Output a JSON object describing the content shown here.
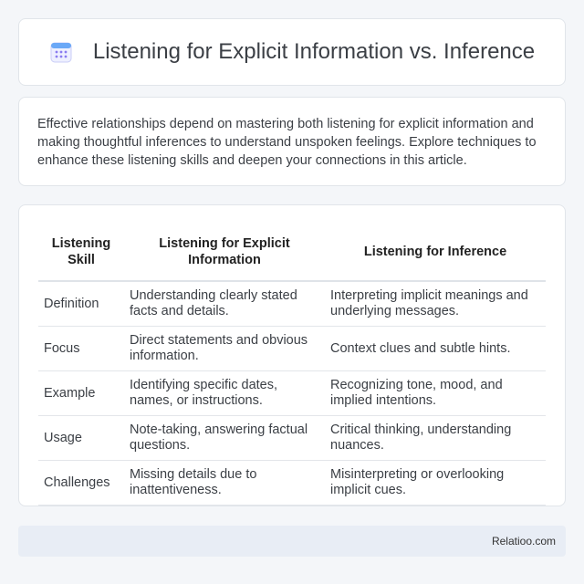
{
  "header": {
    "title": "Listening for Explicit Information vs. Inference",
    "icon": "calendar-icon"
  },
  "intro": {
    "text": "Effective relationships depend on mastering both listening for explicit information and making thoughtful inferences to understand unspoken feelings. Explore techniques to enhance these listening skills and deepen your connections in this article."
  },
  "table": {
    "headers": [
      "Listening Skill",
      "Listening for Explicit Information",
      "Listening for Inference"
    ],
    "rows": [
      [
        "Definition",
        "Understanding clearly stated facts and details.",
        "Interpreting implicit meanings and underlying messages."
      ],
      [
        "Focus",
        "Direct statements and obvious information.",
        "Context clues and subtle hints."
      ],
      [
        "Example",
        "Identifying specific dates, names, or instructions.",
        "Recognizing tone, mood, and implied intentions."
      ],
      [
        "Usage",
        "Note-taking, answering factual questions.",
        "Critical thinking, understanding nuances."
      ],
      [
        "Challenges",
        "Missing details due to inattentiveness.",
        "Misinterpreting or overlooking implicit cues."
      ]
    ]
  },
  "footer": {
    "brand": "Relatioo.com"
  },
  "colors": {
    "background": "#f4f6f9",
    "card": "#ffffff",
    "footer_bg": "#e8edf5",
    "icon_accent": "#7b6cf6"
  }
}
